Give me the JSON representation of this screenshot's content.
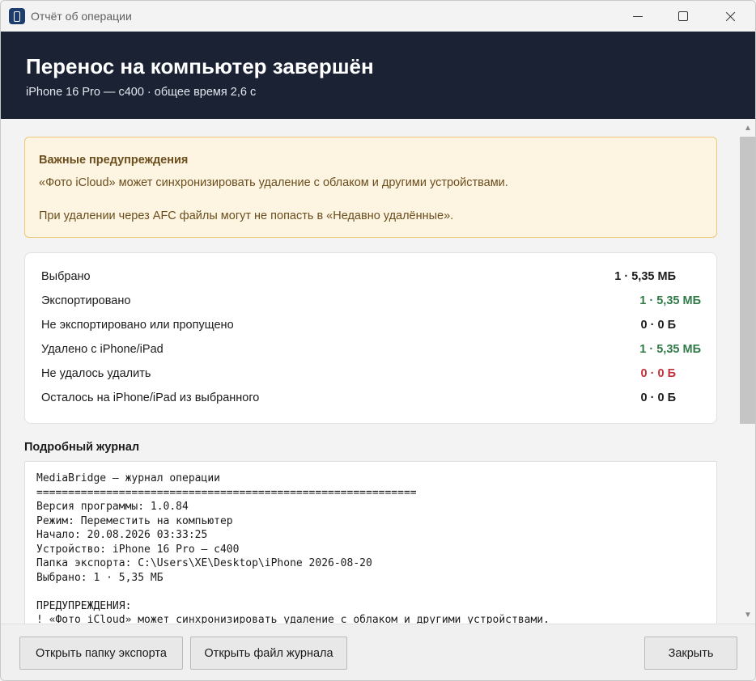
{
  "window": {
    "title": "Отчёт об операции",
    "app_icon": "phone-transfer-icon"
  },
  "header": {
    "title": "Перенос на компьютер завершён",
    "subtitle": "iPhone 16 Pro — c400 · общее время 2,6 с"
  },
  "warnings": {
    "title": "Важные предупреждения",
    "lines": [
      "«Фото iCloud» может синхронизировать удаление с облаком и другими устройствами.",
      "При удалении через AFC файлы могут не попасть в «Недавно удалённые»."
    ]
  },
  "stats": [
    {
      "label": "Выбрано",
      "value": "1 · 5,35 МБ",
      "color": "#1c1c1c"
    },
    {
      "label": "Экспортировано",
      "value": "1 · 5,35 МБ",
      "color": "#2f7a46"
    },
    {
      "label": "Не экспортировано или пропущено",
      "value": "0 · 0 Б",
      "color": "#1c1c1c"
    },
    {
      "label": "Удалено с iPhone/iPad",
      "value": "1 · 5,35 МБ",
      "color": "#2f7a46"
    },
    {
      "label": "Не удалось удалить",
      "value": "0 · 0 Б",
      "color": "#c0303b"
    },
    {
      "label": "Осталось на iPhone/iPad из выбранного",
      "value": "0 · 0 Б",
      "color": "#1c1c1c"
    }
  ],
  "log": {
    "heading": "Подробный журнал",
    "lines": [
      "MediaBridge — журнал операции",
      "============================================================",
      "Версия программы: 1.0.84",
      "Режим: Переместить на компьютер",
      "Начало: 20.08.2026 03:33:25",
      "Устройство: iPhone 16 Pro — c400",
      "Папка экспорта: C:\\Users\\XE\\Desktop\\iPhone 2026-08-20",
      "Выбрано: 1 · 5,35 МБ",
      "",
      "ПРЕДУПРЕЖДЕНИЯ:",
      "! «Фото iCloud» может синхронизировать удаление с облаком и другими устройствами."
    ]
  },
  "footer": {
    "open_export_label": "Открыть папку экспорта",
    "open_log_label": "Открыть файл журнала",
    "close_label": "Закрыть"
  }
}
